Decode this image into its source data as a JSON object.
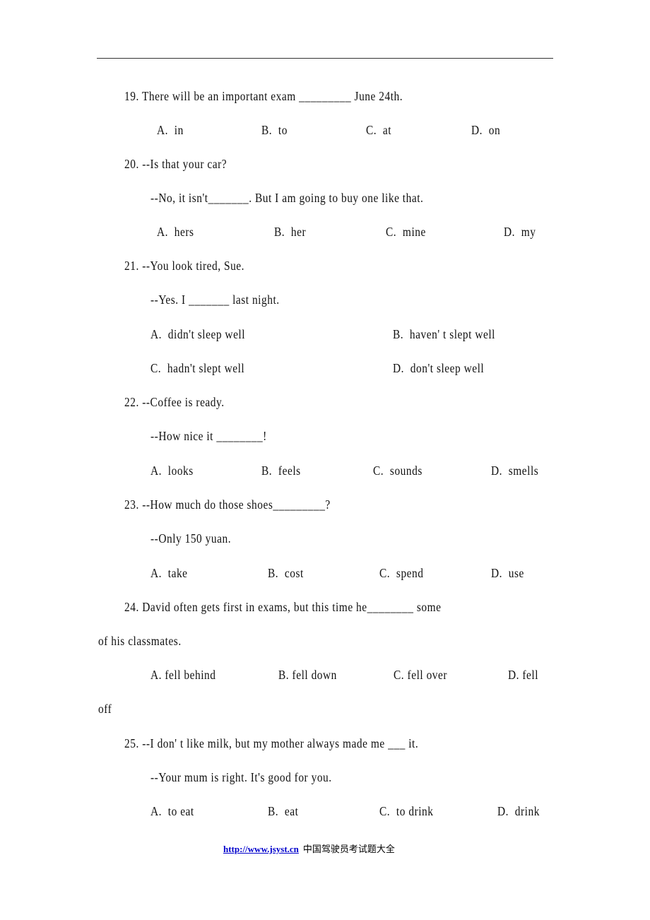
{
  "questions": [
    {
      "number": "19.",
      "lines": [
        {
          "before": "There will be an important exam ",
          "blank": "_________",
          "after": " June 24th."
        }
      ],
      "options": [
        "A.  in",
        "B.  to",
        "C.  at",
        "D.  on"
      ]
    },
    {
      "number": "20.",
      "lines": [
        {
          "before": "--Is that your car?",
          "blank": "",
          "after": ""
        },
        {
          "before": "--No, it isn't",
          "blank": "_______",
          "after": ". But I am going to buy one like that."
        }
      ],
      "options": [
        "A.  hers",
        "B.  her",
        "C.  mine",
        "D.  my"
      ]
    },
    {
      "number": "21.",
      "lines": [
        {
          "before": "--You look tired, Sue.",
          "blank": "",
          "after": ""
        },
        {
          "before": "--Yes. I ",
          "blank": "_______",
          "after": " last night."
        }
      ],
      "options": [
        "A.  didn't sleep well",
        "B.  haven' t slept well",
        "C.  hadn't slept well",
        "D.  don't sleep well"
      ]
    },
    {
      "number": "22.",
      "lines": [
        {
          "before": "--Coffee is ready.",
          "blank": "",
          "after": ""
        },
        {
          "before": "--How nice it ",
          "blank": "________",
          "after": "!"
        }
      ],
      "options": [
        "A.  looks",
        "B.  feels",
        "C.  sounds",
        "D.  smells"
      ]
    },
    {
      "number": "23.",
      "lines": [
        {
          "before": "--How much do those shoes",
          "blank": "_________",
          "after": "?"
        },
        {
          "before": "--Only 150 yuan.",
          "blank": "",
          "after": ""
        }
      ],
      "options": [
        "A.  take",
        "B.  cost",
        "C.  spend",
        "D.  use"
      ]
    },
    {
      "number": "24.",
      "lines": [
        {
          "before": "David often gets first in exams, but this time he",
          "blank": "________",
          "after": " some"
        },
        {
          "before": "of his classmates.",
          "blank": "",
          "after": ""
        }
      ],
      "options": [
        "A. fell behind",
        "B. fell down",
        "C. fell over",
        "D. fell"
      ],
      "options_wrap": "off"
    },
    {
      "number": "25.",
      "lines": [
        {
          "before": "--I don' t like milk, but my mother always made me ",
          "blank": "___",
          "after": " it."
        },
        {
          "before": "--Your mum is right. It's good for you.",
          "blank": "",
          "after": ""
        }
      ],
      "options": [
        "A.  to eat",
        "B.  eat",
        "C.  to drink",
        "D.  drink"
      ]
    }
  ],
  "footer": {
    "link": "http://www.jsyst.cn",
    "text": "中国驾驶员考试题大全"
  }
}
